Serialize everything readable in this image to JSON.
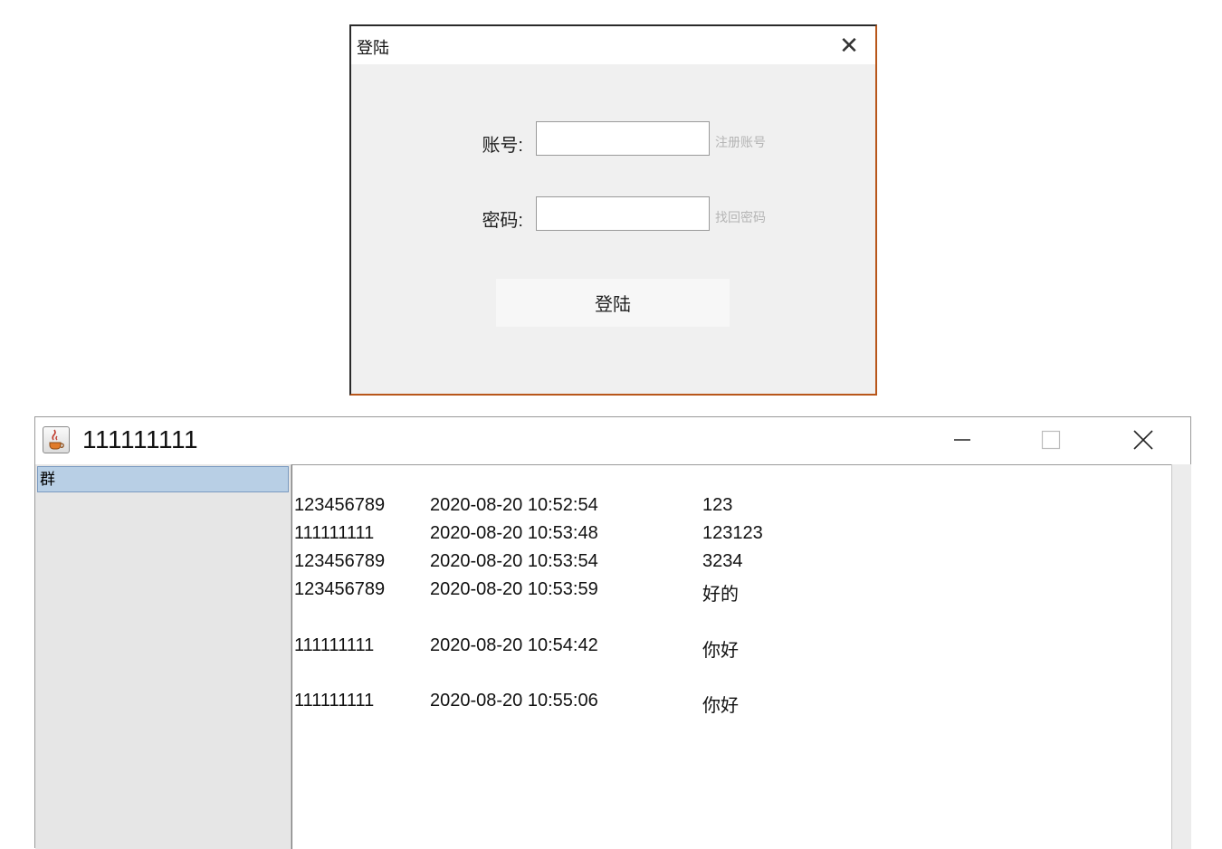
{
  "login_dialog": {
    "title": "登陆",
    "close_glyph": "✕",
    "account_label": "账号:",
    "account_value": "",
    "register_link": "注册账号",
    "password_label": "密码:",
    "password_value": "",
    "recover_link": "找回密码",
    "login_button": "登陆"
  },
  "chat_window": {
    "title": "111111111",
    "icon": "java-icon",
    "sidebar": {
      "items": [
        {
          "label": "群",
          "selected": true
        }
      ]
    },
    "messages": [
      {
        "user": "123456789",
        "time": "2020-08-20 10:52:54",
        "text": "123"
      },
      {
        "user": "111111111",
        "time": "2020-08-20 10:53:48",
        "text": "123123"
      },
      {
        "user": "123456789",
        "time": "2020-08-20 10:53:54",
        "text": "3234"
      },
      {
        "user": "123456789",
        "time": "2020-08-20 10:53:59",
        "text": "好的"
      },
      {
        "user": "111111111",
        "time": "2020-08-20 10:54:42",
        "text": "你好"
      },
      {
        "user": "111111111",
        "time": "2020-08-20 10:55:06",
        "text": "你好"
      }
    ]
  },
  "colors": {
    "selected_item_bg": "#b8cfe5",
    "dialog_bg": "#f0f0f0",
    "sidebar_bg": "#e6e6e6",
    "link_gray": "#b5b5b5"
  }
}
